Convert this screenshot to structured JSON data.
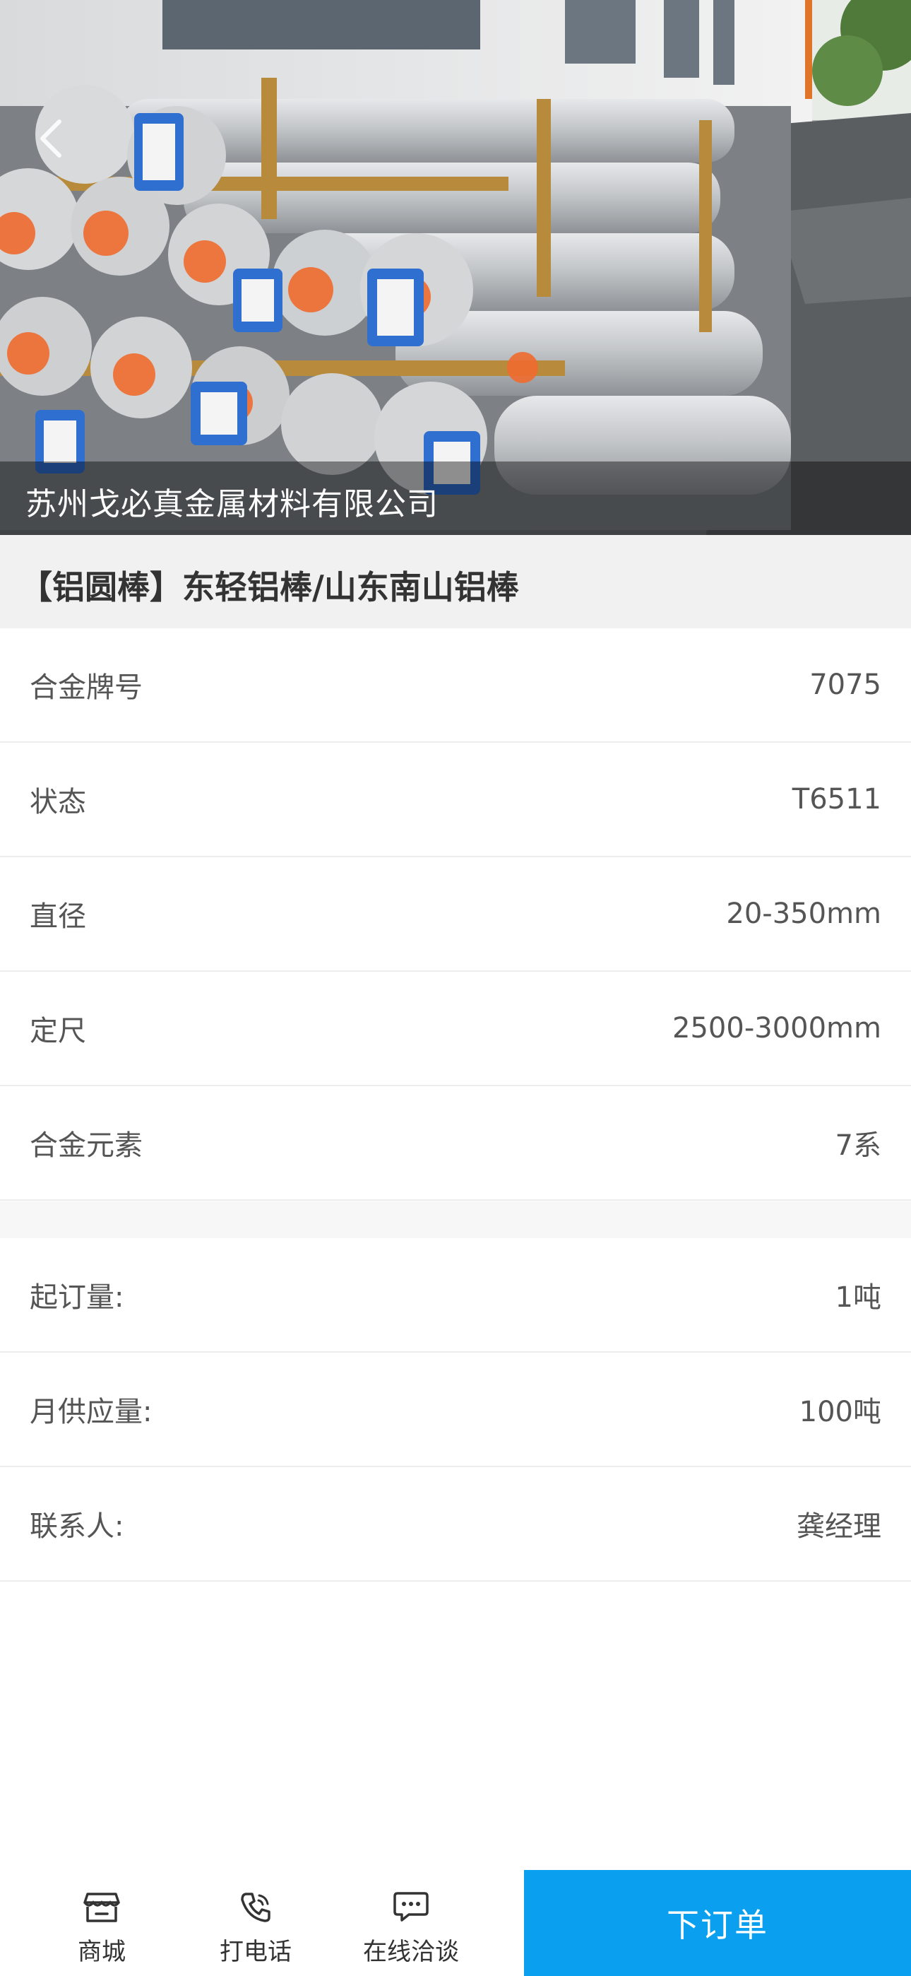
{
  "hero": {
    "company_name": "苏州戈必真金属材料有限公司"
  },
  "product": {
    "title": "【铝圆棒】东轻铝棒/山东南山铝棒"
  },
  "specs": [
    {
      "label": "合金牌号",
      "value": "7075"
    },
    {
      "label": "状态",
      "value": "T6511"
    },
    {
      "label": "直径",
      "value": "20-350mm"
    },
    {
      "label": "定尺",
      "value": "2500-3000mm"
    },
    {
      "label": "合金元素",
      "value": "7系"
    }
  ],
  "supply": [
    {
      "label": "起订量:",
      "value": "1吨"
    },
    {
      "label": "月供应量:",
      "value": "100吨"
    },
    {
      "label": "联系人:",
      "value": "龚经理"
    }
  ],
  "bottom_bar": {
    "tabs": [
      {
        "label": "商城",
        "icon": "store-icon"
      },
      {
        "label": "打电话",
        "icon": "phone-icon"
      },
      {
        "label": "在线洽谈",
        "icon": "chat-icon"
      }
    ],
    "order_label": "下订单"
  },
  "colors": {
    "accent": "#0AA0EF",
    "title_bg": "#F1F1F1",
    "text": "#333333"
  }
}
